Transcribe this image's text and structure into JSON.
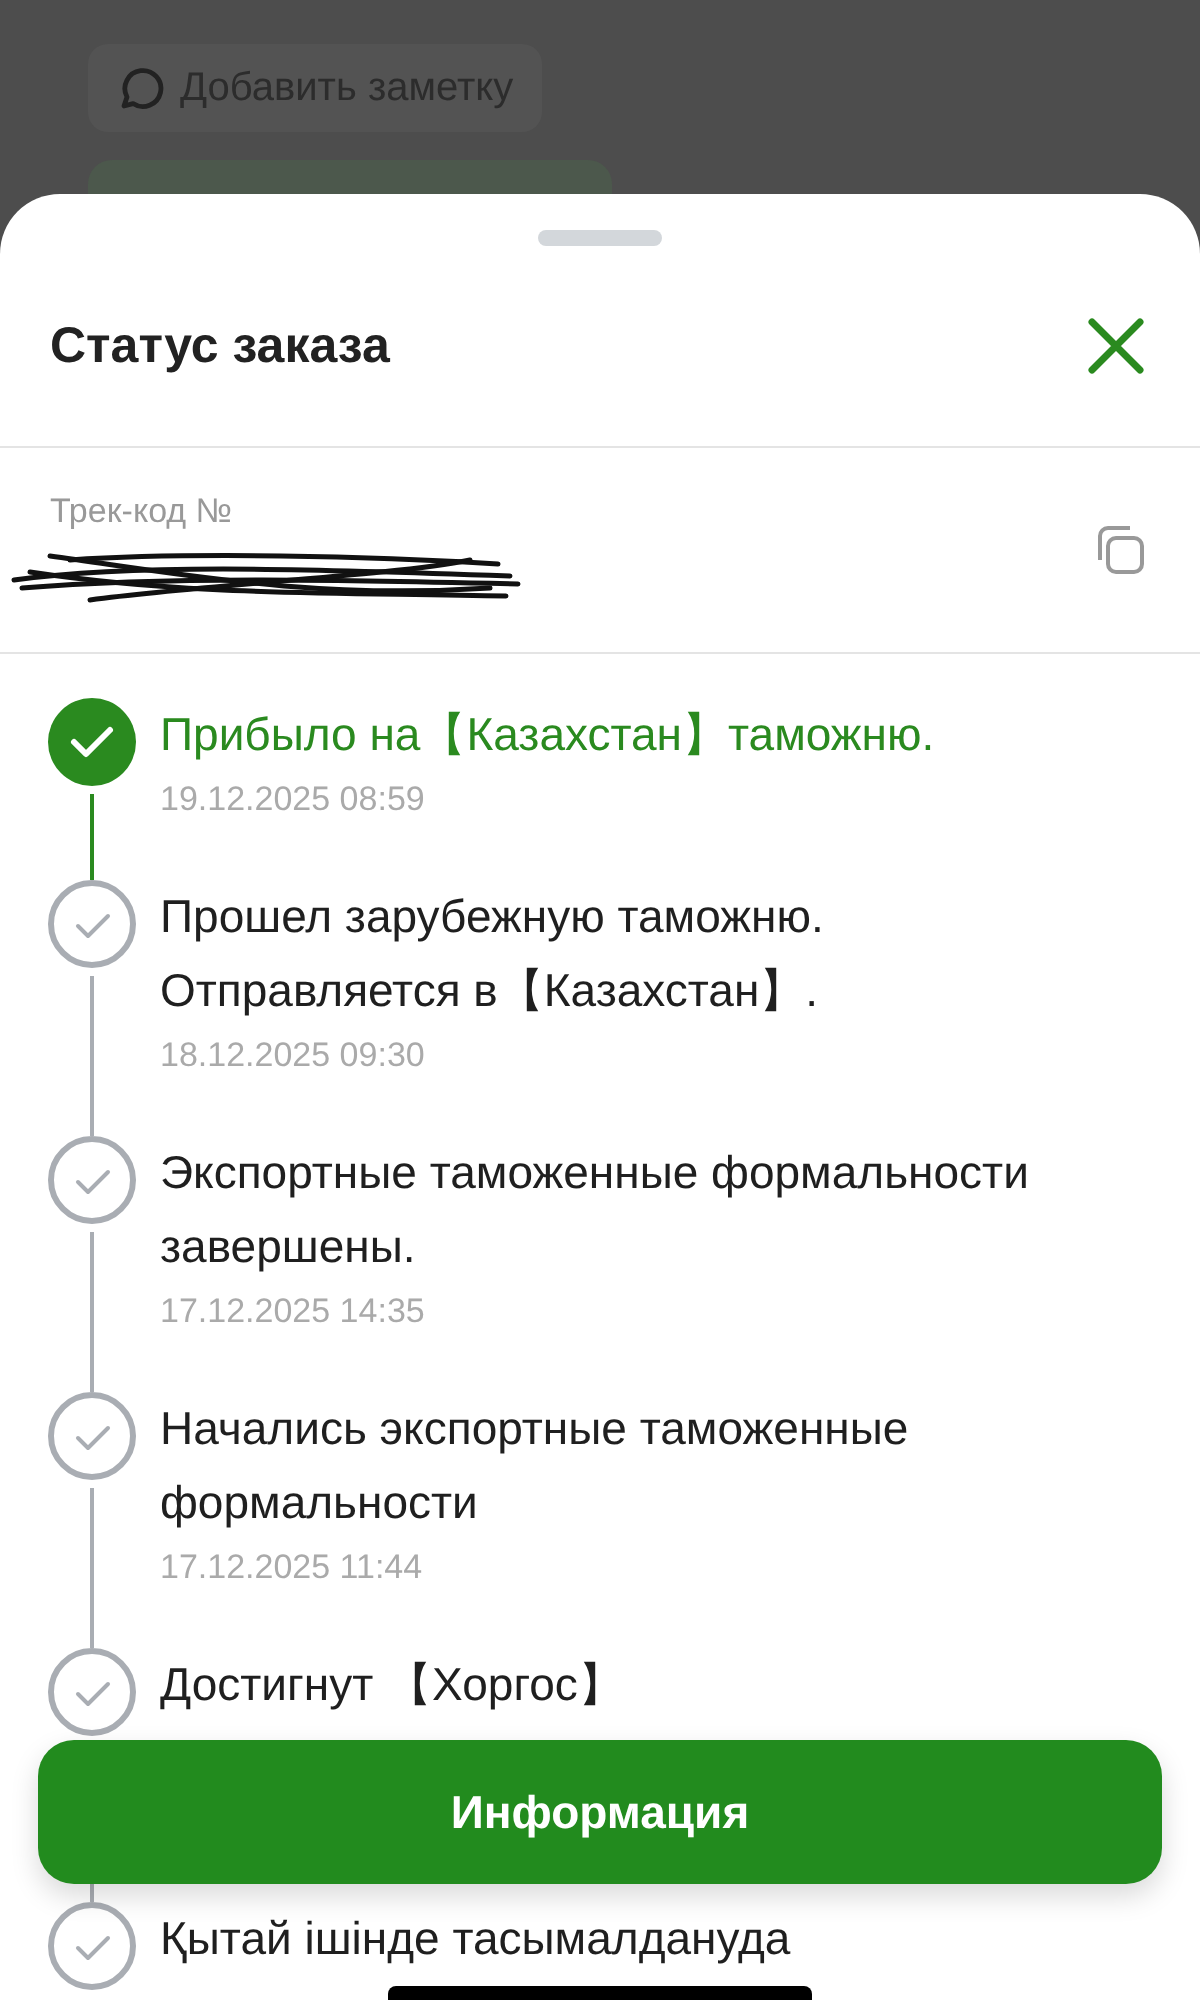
{
  "background": {
    "note_button": "Добавить заметку"
  },
  "sheet": {
    "title": "Статус заказа",
    "track_label": "Трек-код №",
    "events": [
      {
        "title": "Прибыло на【Казахстан】таможню.",
        "date": "19.12.2025 08:59",
        "active": true
      },
      {
        "title": "Прошел зарубежную таможню. Отправляется в【Казахстан】.",
        "date": "18.12.2025 09:30",
        "active": false
      },
      {
        "title": "Экспортные таможенные формальности завершены.",
        "date": "17.12.2025 14:35",
        "active": false
      },
      {
        "title": "Начались экспортные таможенные формальности",
        "date": "17.12.2025 11:44",
        "active": false
      },
      {
        "title": "Достигнут 【Хоргос】",
        "active": false
      },
      {
        "title": "Қытай ішінде тасымалдануда",
        "active": false
      }
    ],
    "info_button": "Информация"
  }
}
